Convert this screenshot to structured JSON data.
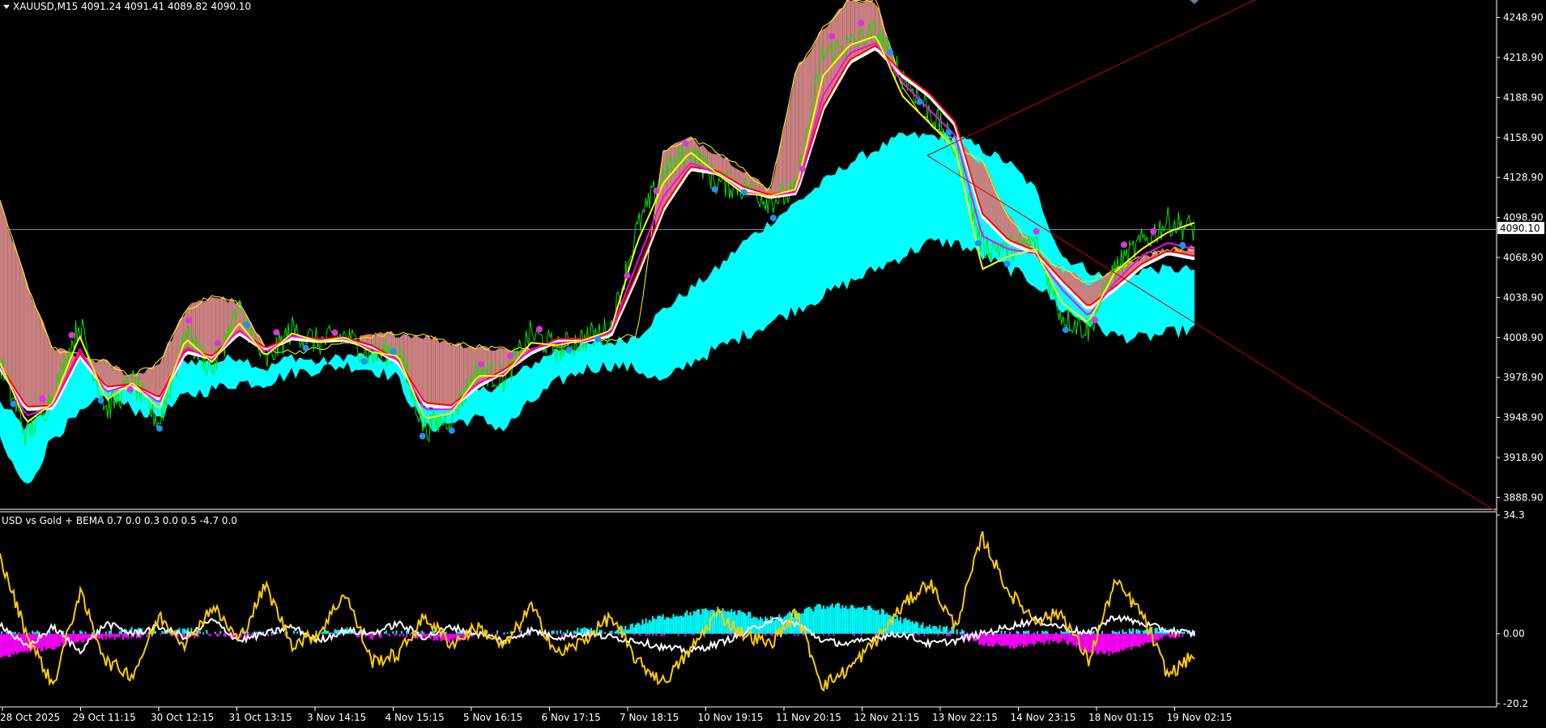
{
  "main_title": "XAUUSD,M15  4091.24 4091.41 4089.82 4090.10",
  "indicator_title": "USD vs Gold + BEMA 0.7 0.0 0.3 0.0 0.5 -4.7 0.0",
  "last_price_label": "4090.10",
  "colors": {
    "background": "#000000",
    "axis": "#ffffff",
    "price": "#00e600",
    "ma_yellow": "#ffff00",
    "ma_magenta": "#ff00ff",
    "ma_red": "#ff0000",
    "ma_white": "#ffffff",
    "cloud_cyan": "#00ffff",
    "cloud_pink": "#c87f7f",
    "trendline": "#d10000",
    "osc_gold": "#ffcc00",
    "osc_white": "#ffffff",
    "hist_cyan": "#00ffff",
    "hist_magenta": "#ff00ff",
    "marker_blue": "#1e90ff",
    "marker_magenta": "#dd33dd",
    "hline": "#6f8fa8"
  },
  "chart_data": [
    {
      "type": "line",
      "name": "XAUUSD,M15 price",
      "y_ticks": [
        "4248.90",
        "4218.90",
        "4188.90",
        "4158.90",
        "4128.90",
        "4098.90",
        "4068.90",
        "4038.90",
        "4008.90",
        "3978.90",
        "3948.90",
        "3918.90",
        "3888.90"
      ],
      "ylim": [
        3880,
        4262
      ],
      "x_ticks": [
        "28 Oct 2025",
        "29 Oct 11:15",
        "30 Oct 12:15",
        "31 Oct 13:15",
        "3 Nov 14:15",
        "4 Nov 15:15",
        "5 Nov 16:15",
        "6 Nov 17:15",
        "7 Nov 18:15",
        "10 Nov 19:15",
        "11 Nov 20:15",
        "12 Nov 21:15",
        "13 Nov 22:15",
        "14 Nov 23:15",
        "18 Nov 01:15",
        "19 Nov 02:15"
      ],
      "last_price": 4090.1,
      "price_anchors": [
        3990,
        3935,
        3965,
        4020,
        3955,
        3975,
        3945,
        4010,
        3985,
        4030,
        3990,
        4015,
        4005,
        4010,
        3995,
        4000,
        3940,
        3950,
        3985,
        3978,
        4012,
        4000,
        4008,
        4015,
        4090,
        4132,
        4150,
        4125,
        4122,
        4112,
        4118,
        4222,
        4228,
        4238,
        4205,
        4180,
        4150,
        4078,
        4076,
        4080,
        4025,
        4015,
        4060,
        4080,
        4096,
        4090.1
      ],
      "ma_yellow": [
        3990,
        3945,
        3960,
        4010,
        3962,
        3975,
        3955,
        4008,
        3990,
        4020,
        3995,
        4012,
        4006,
        4009,
        3998,
        3995,
        3948,
        3952,
        3980,
        3980,
        4005,
        4003,
        4007,
        4014,
        4080,
        4125,
        4148,
        4132,
        4117,
        4115,
        4120,
        4205,
        4228,
        4235,
        4190,
        4170,
        4150,
        4060,
        4070,
        4075,
        4035,
        4020,
        4058,
        4075,
        4088,
        4095
      ],
      "ma_magenta": [
        3988,
        3950,
        3958,
        4000,
        3968,
        3974,
        3960,
        4002,
        3992,
        4015,
        3998,
        4010,
        4007,
        4008,
        4000,
        3992,
        3955,
        3955,
        3975,
        3982,
        4000,
        4005,
        4006,
        4012,
        4065,
        4115,
        4140,
        4132,
        4118,
        4115,
        4118,
        4190,
        4222,
        4230,
        4200,
        4180,
        4160,
        4085,
        4075,
        4072,
        4045,
        4025,
        4050,
        4070,
        4080,
        4075
      ],
      "ma_white": [
        3986,
        3955,
        3956,
        3995,
        3970,
        3972,
        3962,
        3998,
        3993,
        4012,
        3999,
        4008,
        4006,
        4007,
        4001,
        3990,
        3958,
        3956,
        3972,
        3983,
        3997,
        4006,
        4006,
        4010,
        4055,
        4105,
        4135,
        4132,
        4120,
        4114,
        4117,
        4180,
        4215,
        4226,
        4205,
        4190,
        4168,
        4100,
        4080,
        4072,
        4050,
        4030,
        4045,
        4062,
        4072,
        4068
      ],
      "cloud_cyan_top": [
        3960,
        3940,
        3958,
        3995,
        3985,
        3980,
        3970,
        3992,
        3990,
        3995,
        3985,
        3995,
        3990,
        3995,
        3995,
        3990,
        3955,
        3958,
        3968,
        3975,
        3988,
        4000,
        4003,
        4005,
        4010,
        4030,
        4045,
        4060,
        4080,
        4095,
        4110,
        4125,
        4140,
        4150,
        4160,
        4160,
        4160,
        4150,
        4140,
        4120,
        4070,
        4060,
        4050,
        4060,
        4060,
        4060
      ],
      "cloud_cyan_bottom": [
        3930,
        3895,
        3935,
        3950,
        3965,
        3955,
        3950,
        3965,
        3970,
        3975,
        3975,
        3982,
        3985,
        3988,
        3985,
        3978,
        3940,
        3945,
        3948,
        3940,
        3960,
        3975,
        3985,
        3988,
        3985,
        3975,
        3990,
        4000,
        4010,
        4020,
        4030,
        4040,
        4050,
        4060,
        4070,
        4080,
        4080,
        4070,
        4060,
        4050,
        4030,
        4020,
        4010,
        4008,
        4012,
        4015
      ],
      "cloud_pink_top": [
        4110,
        4050,
        4000,
        3995,
        3990,
        3980,
        3990,
        4030,
        4040,
        4035,
        4000,
        3998,
        4000,
        4005,
        4010,
        4012,
        4010,
        4005,
        4002,
        4000,
        4000,
        4003,
        4006,
        4008,
        4010,
        4150,
        4158,
        4148,
        4135,
        4118,
        4210,
        4240,
        4262,
        4262,
        4195,
        4170,
        4155,
        4140,
        4100,
        4075,
        4060,
        4050,
        4060,
        4070,
        4075,
        4075
      ],
      "nov13_high_label": "4248.90"
    },
    {
      "type": "line",
      "name": "USD vs Gold + BEMA",
      "y_ticks": [
        "34.3",
        "0.00",
        "-20.2"
      ],
      "ylim": [
        -20.2,
        34.3
      ],
      "gold_line": [
        22,
        0,
        -15,
        12,
        -8,
        -12,
        5,
        -3,
        8,
        -2,
        14,
        -3,
        0,
        12,
        -8,
        -6,
        5,
        -3,
        2,
        -4,
        8,
        -6,
        -2,
        5,
        -8,
        -14,
        -5,
        6,
        0,
        -3,
        6,
        -15,
        -10,
        -2,
        8,
        15,
        2,
        28,
        12,
        4,
        6,
        -8,
        15,
        6,
        -12,
        -6
      ],
      "white_line": [
        3,
        -4,
        2,
        -5,
        3,
        0,
        2,
        -1,
        4,
        -2,
        0,
        2,
        -2,
        1,
        0,
        3,
        -1,
        2,
        0,
        -2,
        1,
        -1,
        0,
        -1,
        -2,
        -4,
        -5,
        -3,
        0,
        4,
        3,
        -2,
        -3,
        -1,
        0,
        -3,
        -2,
        0,
        2,
        4,
        2,
        0,
        5,
        3,
        1,
        0
      ],
      "hist_cyan": [
        0,
        0,
        0,
        0,
        0,
        1,
        0,
        1,
        0,
        0,
        0,
        0,
        0,
        1,
        0,
        0,
        0,
        0,
        0,
        0,
        0,
        0,
        1,
        0,
        3,
        5,
        6,
        7,
        6,
        4,
        6,
        8,
        8,
        7,
        4,
        2,
        1,
        0,
        0,
        0,
        0,
        0,
        0,
        1,
        1,
        0
      ],
      "hist_magenta": [
        -7,
        -5,
        -4,
        -2,
        -1,
        -1,
        0,
        -1,
        0,
        -1,
        0,
        0,
        0,
        0,
        -1,
        0,
        -1,
        -2,
        0,
        0,
        0,
        0,
        0,
        0,
        0,
        0,
        0,
        0,
        0,
        0,
        0,
        0,
        0,
        0,
        0,
        0,
        0,
        -3,
        -4,
        -3,
        -2,
        -5,
        -6,
        -3,
        -1,
        0
      ]
    }
  ]
}
